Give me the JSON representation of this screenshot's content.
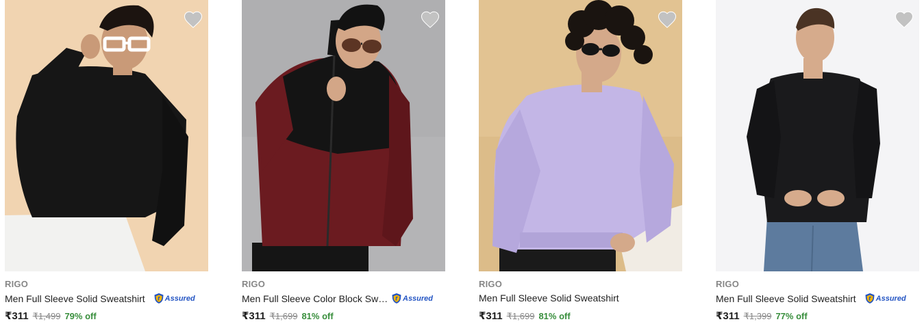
{
  "products": [
    {
      "brand": "RIGO",
      "title": "Men Full Sleeve Solid Sweatshirt",
      "assured": true,
      "assured_label": "Assured",
      "price": "₹311",
      "mrp": "₹1,499",
      "discount": "79% off",
      "image": {
        "bg": "#f3d8b8",
        "garment": "#161616",
        "skin": "#c99a78",
        "icon": "model-black-sweatshirt-white-glasses"
      }
    },
    {
      "brand": "RIGO",
      "title": "Men Full Sleeve Color Block Swe...",
      "assured": true,
      "assured_label": "Assured",
      "price": "₹311",
      "mrp": "₹1,699",
      "discount": "81% off",
      "image": {
        "bg": "#b4b4b6",
        "garment": "#6b1b20",
        "skin": "#d3a687",
        "icon": "model-maroon-black-zip-jacket"
      }
    },
    {
      "brand": "RIGO",
      "title": "Men Full Sleeve Solid Sweatshirt",
      "assured": false,
      "assured_label": "",
      "price": "₹311",
      "mrp": "₹1,699",
      "discount": "81% off",
      "image": {
        "bg": "#e2c392",
        "garment": "#c3b6e6",
        "skin": "#d4a98a",
        "icon": "model-lavender-sweatshirt"
      }
    },
    {
      "brand": "RIGO",
      "title": "Men Full Sleeve Solid Sweatshirt",
      "assured": true,
      "assured_label": "Assured",
      "price": "₹311",
      "mrp": "₹1,399",
      "discount": "77% off",
      "image": {
        "bg": "#f4f4f6",
        "garment": "#1a1a1c",
        "skin": "#d6ab8c",
        "icon": "model-black-sweatshirt-jeans"
      }
    }
  ],
  "colors": {
    "heart": "#c2c2c2",
    "assured_blue": "#2455c3",
    "assured_gold": "#f5b400",
    "discount_green": "#388e3c",
    "mrp_grey": "#878787",
    "brand_grey": "#878787"
  }
}
